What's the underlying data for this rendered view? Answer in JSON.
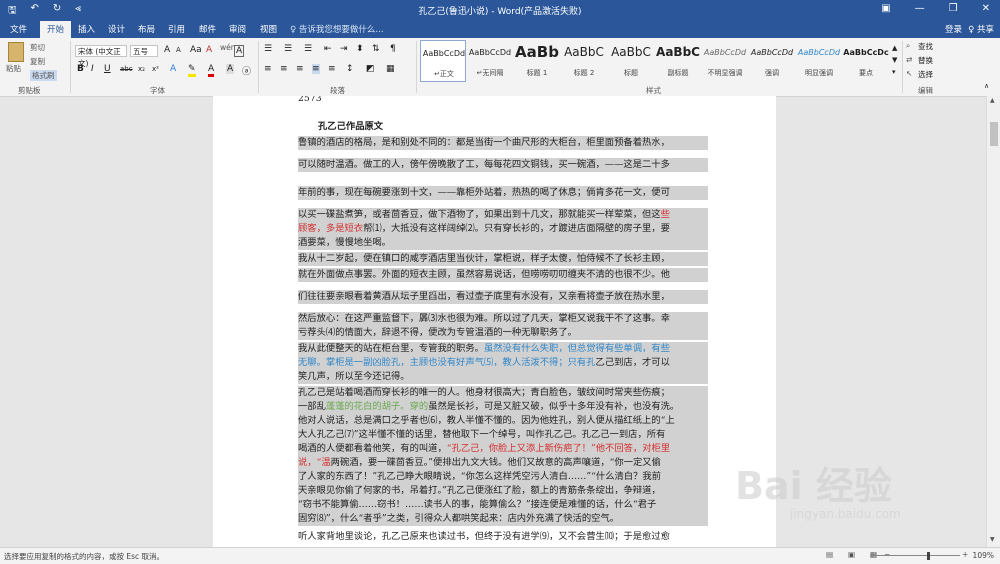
{
  "titlebar": {
    "title": "孔乙己(鲁迅小说) - Word(产品激活失败)",
    "qat": [
      "save-icon",
      "undo-icon",
      "redo-icon",
      "customize-icon"
    ],
    "window": [
      "ribbon-options-icon",
      "minimize-icon",
      "restore-icon",
      "close-icon"
    ]
  },
  "tabs": [
    "文件",
    "开始",
    "插入",
    "设计",
    "布局",
    "引用",
    "邮件",
    "审阅",
    "视图"
  ],
  "tell_me": "♀ 告诉我您想要做什么...",
  "login": "登录",
  "share": "♀ 共享",
  "ribbon": {
    "clipboard": {
      "label": "剪贴板",
      "paste": "粘贴",
      "cut": "剪切",
      "copy": "复制",
      "format_painter": "格式刷"
    },
    "font": {
      "label": "字体",
      "font_name": "宋体 (中文正文)",
      "font_size": "五号",
      "wen": "wén",
      "bold": "B",
      "italic": "I",
      "underline": "U",
      "strike": "abc",
      "sub": "x₂",
      "sup": "x²",
      "grow": "A",
      "shrink": "A",
      "clear": "A",
      "color_a": "A",
      "border_a": "A"
    },
    "paragraph": {
      "label": "段落"
    },
    "styles": {
      "label": "样式",
      "items": [
        {
          "sample": "AaBbCcDd",
          "name": "↵正文"
        },
        {
          "sample": "AaBbCcDd",
          "name": "↵无间隔"
        },
        {
          "sample": "AaBb",
          "name": "标题 1"
        },
        {
          "sample": "AaBbC",
          "name": "标题 2"
        },
        {
          "sample": "AaBbC",
          "name": "标题"
        },
        {
          "sample": "AaBbC",
          "name": "副标题"
        },
        {
          "sample": "AaBbCcDd",
          "name": "不明显强调"
        },
        {
          "sample": "AaBbCcDd",
          "name": "强调"
        },
        {
          "sample": "AaBbCcDd",
          "name": "明显强调"
        },
        {
          "sample": "AaBbCcDc",
          "name": "要点"
        }
      ]
    },
    "editing": {
      "label": "编辑",
      "find": "查找",
      "replace": "替换",
      "select": "选择"
    }
  },
  "document": {
    "top_number": "2573",
    "heading": "孔乙己作品原文",
    "lines": [
      [
        {
          "t": "鲁镇的酒店的格局，是和别处不同的：都是当街一个曲尺形的大柜台，柜里面预备着热水，",
          "c": ""
        }
      ],
      [
        {
          "t": "可以随时温酒。做工的人，傍午傍晚散了工，每每花四文铜钱，买一碗酒，——这是二十多",
          "c": ""
        }
      ],
      [
        {
          "t": "年前的事，现在每碗要涨到十文，——靠柜外站着，热热的喝了休息；倘肯多花一文，便可",
          "c": ""
        }
      ],
      [
        {
          "t": "以买一碟盐煮笋，或者茴香豆，做下酒物了，如果出到十几文，那就能买一样荤菜，但这",
          "c": ""
        },
        {
          "t": "些",
          "c": "red"
        }
      ],
      [
        {
          "t": "顾客，多是短衣",
          "c": "red"
        },
        {
          "t": "帮⑴，大抵没有这样阔绰⑵。只有穿长衫的，才踱进店面隔壁的房子里，要",
          "c": ""
        }
      ],
      [
        {
          "t": "酒要菜，慢慢地坐喝。",
          "c": ""
        }
      ],
      [
        {
          "t": "我从十二岁起，便在镇口的咸亨酒店里当伙计，掌柜说，样子太傻，怕侍候不了长衫主顾，",
          "c": ""
        }
      ],
      [
        {
          "t": "就在外面做点事罢。外面的短衣主顾，虽然容易说话，但唠唠叨叨缠夹不清的也很不少。他",
          "c": ""
        }
      ],
      [
        {
          "t": "们往往要亲眼看着黄酒从坛子里舀出，看过壶子底里有水没有，又亲看将壶子放在热水里，",
          "c": ""
        }
      ],
      [
        {
          "t": "然后放心：在这严重监督下，羼⑶水也很为难。所以过了几天，掌柜又说我干不了这事。幸",
          "c": ""
        }
      ],
      [
        {
          "t": "亏荐头⑷的情面大，辞退不得，便改为专管温酒的一种无聊职务了。",
          "c": ""
        }
      ],
      [
        {
          "t": "我从此便整天的站在柜台里，专管我的职务。",
          "c": ""
        },
        {
          "t": "虽然没有什么失职，但总觉得有些单调，有些",
          "c": "blue"
        }
      ],
      [
        {
          "t": "无聊。掌柜是一副凶脸孔，主顾也没有好声气⑸，教人活泼不得；只有孔",
          "c": "blue"
        },
        {
          "t": "乙己到店，才可以",
          "c": ""
        }
      ],
      [
        {
          "t": "笑几声，所以至今还记得。",
          "c": ""
        }
      ],
      [
        {
          "t": "孔乙己是站着喝酒而穿长衫的唯一的人。他身材很高大；青白脸色，皱纹间时常夹些伤痕；",
          "c": ""
        }
      ],
      [
        {
          "t": "一部乱",
          "c": ""
        },
        {
          "t": "蓬蓬的花白的胡子。穿的",
          "c": "green"
        },
        {
          "t": "虽然是长衫，可是又脏又破，似乎十多年没有补，也没有洗。",
          "c": ""
        }
      ],
      [
        {
          "t": "他对人说话，总是满口之乎者也⑹，教人半懂不懂的。因为他姓孔，别人便从描红纸上的“上",
          "c": ""
        }
      ],
      [
        {
          "t": "大人孔乙己⑺”这半懂不懂的话里，替他取下一个绰号，叫作孔乙己。孔乙己一到店，所有",
          "c": ""
        }
      ],
      [
        {
          "t": "喝酒的人便都看着他笑，有的叫道，",
          "c": ""
        },
        {
          "t": "“孔乙己，你脸上又添上新伤疤了！”他不回答，对柜里",
          "c": "red"
        }
      ],
      [
        {
          "t": "说，“温",
          "c": "red"
        },
        {
          "t": "两碗酒，要一碟茴香豆。”便排出九文大钱。他们又故意的高声嚷道，“你一定又偷",
          "c": ""
        }
      ],
      [
        {
          "t": "了人家的东西了！”孔乙己睁大眼睛说，“你怎么这样凭空污人清白……”“什么清白？我前",
          "c": ""
        }
      ],
      [
        {
          "t": "天亲眼见你偷了何家的书，吊着打。”孔乙己便涨红了脸，额上的青筋条条绽出，争辩道，",
          "c": ""
        }
      ],
      [
        {
          "t": "“窃书不能算偷……窃书！……读书人的事，能算偷么？”接连便是难懂的话，什么“君子",
          "c": ""
        }
      ],
      [
        {
          "t": "固穷⑻”，什么“者乎”之类，引得众人都哄笑起来：店内外充满了快活的空气。",
          "c": ""
        }
      ],
      [
        {
          "t": "听人家背地里谈论，孔乙己原来也读过书，但终于没有进学⑼，又不会营生⑽；于是愈过愈",
          "c": ""
        }
      ]
    ]
  },
  "status": {
    "message": "选择要应用复制的格式的内容，或按 Esc 取消。",
    "zoom": "109%"
  },
  "watermark": {
    "logo": "Bai 经验",
    "url": "jingyan.baidu.com"
  }
}
